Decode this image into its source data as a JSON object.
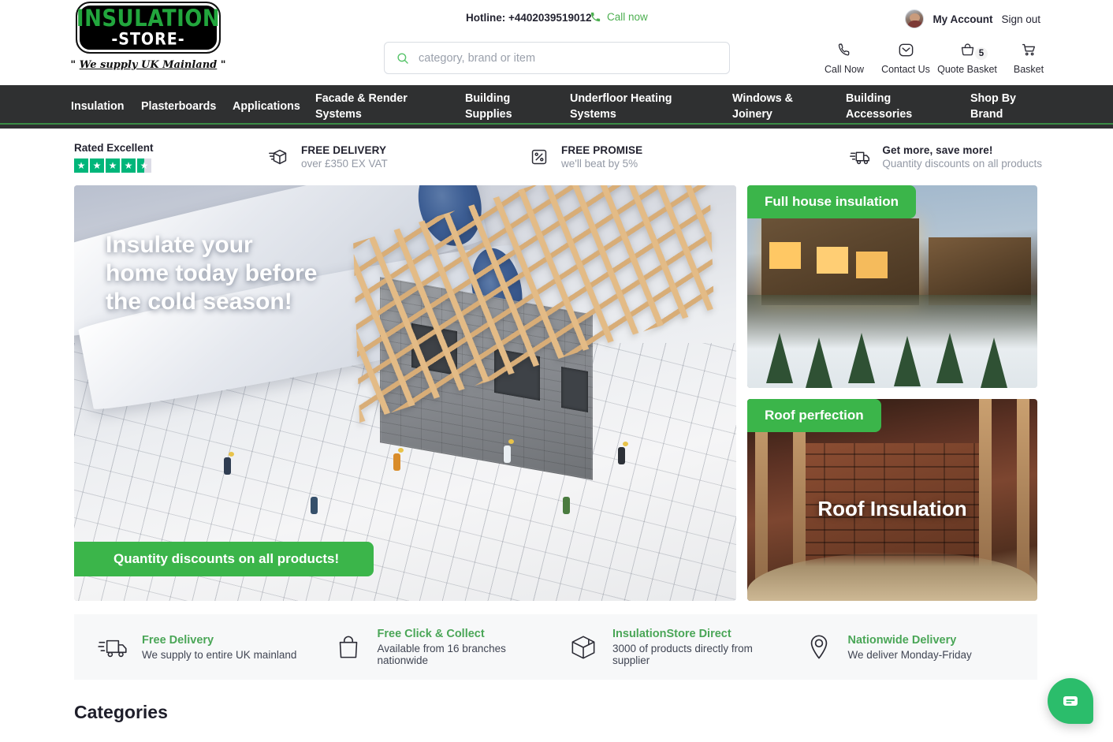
{
  "header": {
    "logo": {
      "line1": "INSULATION",
      "line2": "-STORE-",
      "tagline_open": "\" ",
      "tagline": "We supply UK Mainland",
      "tagline_close": " \""
    },
    "hotline_label": "Hotline: +4402039519012",
    "call_now_link": "Call now",
    "search": {
      "placeholder": "category, brand or item",
      "value": ""
    },
    "my_account": "My Account",
    "sign_out": "Sign out",
    "utilities": [
      {
        "name": "call-now",
        "label": "Call Now",
        "icon": "phone-icon",
        "badge": ""
      },
      {
        "name": "contact-us",
        "label": "Contact Us",
        "icon": "envelope-icon",
        "badge": ""
      },
      {
        "name": "quote-basket",
        "label": "Quote Basket",
        "icon": "bag-icon",
        "badge": "5"
      },
      {
        "name": "basket",
        "label": "Basket",
        "icon": "cart-icon",
        "badge": ""
      }
    ]
  },
  "nav": {
    "items": [
      {
        "label": "Insulation"
      },
      {
        "label": "Plasterboards"
      },
      {
        "label": "Applications"
      },
      {
        "label": "Facade & Render\nSystems"
      },
      {
        "label": "Building\nSupplies"
      },
      {
        "label": "Underfloor Heating\nSystems"
      },
      {
        "label": "Windows &\nJoinery"
      },
      {
        "label": "Building\nAccessories"
      },
      {
        "label": "Shop By\nBrand"
      }
    ],
    "accent_color": "#3b8c46",
    "background": "#2f3031"
  },
  "benefits": {
    "rated_label": "Rated Excellent",
    "rating_stars": 4.5,
    "items": [
      {
        "icon": "box-delivery-icon",
        "title": "FREE DELIVERY",
        "subtitle": "over £350 EX VAT"
      },
      {
        "icon": "percent-tag-icon",
        "title": "FREE PROMISE",
        "subtitle": "we'll beat by 5%"
      },
      {
        "icon": "truck-icon",
        "title": "Get more, save more!",
        "subtitle": "Quantity discounts on all products"
      }
    ]
  },
  "hero": {
    "title": "Insulate your\nhome today before\nthe cold season!",
    "cta_label": "Quantity discounts on all products!",
    "cta_color": "#3bb54a",
    "cards": [
      {
        "chip": "Full house insulation",
        "title": ""
      },
      {
        "chip": "Roof perfection",
        "title": "Roof Insulation"
      }
    ]
  },
  "features": [
    {
      "icon": "delivery-truck-icon",
      "title": "Free Delivery",
      "subtitle": "We supply to entire UK mainland"
    },
    {
      "icon": "shopping-bag-icon",
      "title": "Free Click & Collect",
      "subtitle": "Available from 16 branches nationwide"
    },
    {
      "icon": "package-box-icon",
      "title": "InsulationStore Direct",
      "subtitle": "3000 of products directly from supplier"
    },
    {
      "icon": "map-pin-icon",
      "title": "Nationwide Delivery",
      "subtitle": "We deliver Monday-Friday"
    }
  ],
  "sections": {
    "categories_heading": "Categories"
  },
  "chat": {
    "icon": "chat-bubble-icon",
    "color": "#2bbd6b"
  }
}
